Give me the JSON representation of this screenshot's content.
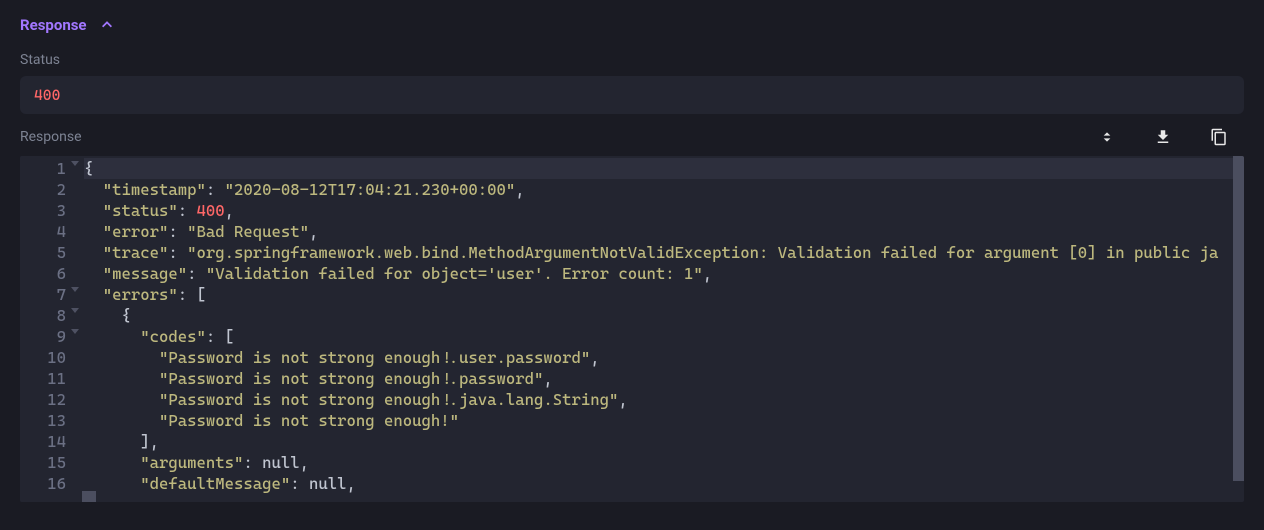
{
  "header": {
    "title": "Response"
  },
  "status": {
    "label": "Status",
    "value": "400"
  },
  "response": {
    "label": "Response"
  },
  "code": {
    "lines": [
      {
        "num": "1",
        "fold": true,
        "indent": "",
        "tokens": [
          {
            "t": "punct",
            "v": "{"
          }
        ]
      },
      {
        "num": "2",
        "fold": false,
        "indent": "  ",
        "tokens": [
          {
            "t": "key",
            "v": "\"timestamp\""
          },
          {
            "t": "punct",
            "v": ": "
          },
          {
            "t": "string",
            "v": "\"2020-08-12T17:04:21.230+00:00\""
          },
          {
            "t": "punct",
            "v": ","
          }
        ]
      },
      {
        "num": "3",
        "fold": false,
        "indent": "  ",
        "tokens": [
          {
            "t": "key",
            "v": "\"status\""
          },
          {
            "t": "punct",
            "v": ": "
          },
          {
            "t": "number",
            "v": "400"
          },
          {
            "t": "punct",
            "v": ","
          }
        ]
      },
      {
        "num": "4",
        "fold": false,
        "indent": "  ",
        "tokens": [
          {
            "t": "key",
            "v": "\"error\""
          },
          {
            "t": "punct",
            "v": ": "
          },
          {
            "t": "string",
            "v": "\"Bad Request\""
          },
          {
            "t": "punct",
            "v": ","
          }
        ]
      },
      {
        "num": "5",
        "fold": false,
        "indent": "  ",
        "tokens": [
          {
            "t": "key",
            "v": "\"trace\""
          },
          {
            "t": "punct",
            "v": ": "
          },
          {
            "t": "string",
            "v": "\"org.springframework.web.bind.MethodArgumentNotValidException: Validation failed for argument [0] in public ja"
          }
        ]
      },
      {
        "num": "6",
        "fold": false,
        "indent": "  ",
        "tokens": [
          {
            "t": "key",
            "v": "\"message\""
          },
          {
            "t": "punct",
            "v": ": "
          },
          {
            "t": "string",
            "v": "\"Validation failed for object='user'. Error count: 1\""
          },
          {
            "t": "punct",
            "v": ","
          }
        ]
      },
      {
        "num": "7",
        "fold": true,
        "indent": "  ",
        "tokens": [
          {
            "t": "key",
            "v": "\"errors\""
          },
          {
            "t": "punct",
            "v": ": ["
          }
        ]
      },
      {
        "num": "8",
        "fold": true,
        "indent": "    ",
        "tokens": [
          {
            "t": "punct",
            "v": "{"
          }
        ]
      },
      {
        "num": "9",
        "fold": true,
        "indent": "      ",
        "tokens": [
          {
            "t": "key",
            "v": "\"codes\""
          },
          {
            "t": "punct",
            "v": ": ["
          }
        ]
      },
      {
        "num": "10",
        "fold": false,
        "indent": "        ",
        "tokens": [
          {
            "t": "string",
            "v": "\"Password is not strong enough!.user.password\""
          },
          {
            "t": "punct",
            "v": ","
          }
        ]
      },
      {
        "num": "11",
        "fold": false,
        "indent": "        ",
        "tokens": [
          {
            "t": "string",
            "v": "\"Password is not strong enough!.password\""
          },
          {
            "t": "punct",
            "v": ","
          }
        ]
      },
      {
        "num": "12",
        "fold": false,
        "indent": "        ",
        "tokens": [
          {
            "t": "string",
            "v": "\"Password is not strong enough!.java.lang.String\""
          },
          {
            "t": "punct",
            "v": ","
          }
        ]
      },
      {
        "num": "13",
        "fold": false,
        "indent": "        ",
        "tokens": [
          {
            "t": "string",
            "v": "\"Password is not strong enough!\""
          }
        ]
      },
      {
        "num": "14",
        "fold": false,
        "indent": "      ",
        "tokens": [
          {
            "t": "punct",
            "v": "],"
          }
        ]
      },
      {
        "num": "15",
        "fold": false,
        "indent": "      ",
        "tokens": [
          {
            "t": "key",
            "v": "\"arguments\""
          },
          {
            "t": "punct",
            "v": ": "
          },
          {
            "t": "null",
            "v": "null"
          },
          {
            "t": "punct",
            "v": ","
          }
        ]
      },
      {
        "num": "16",
        "fold": false,
        "indent": "      ",
        "tokens": [
          {
            "t": "key",
            "v": "\"defaultMessage\""
          },
          {
            "t": "punct",
            "v": ": "
          },
          {
            "t": "null",
            "v": "null"
          },
          {
            "t": "punct",
            "v": ","
          }
        ]
      }
    ]
  }
}
